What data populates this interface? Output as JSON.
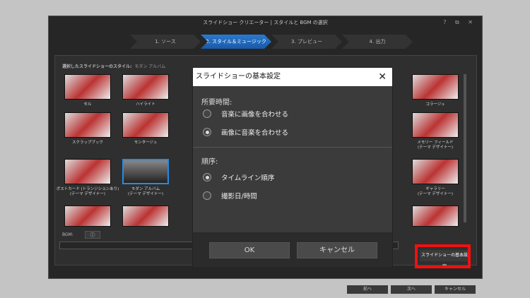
{
  "window": {
    "title": "スライドショー クリエーター | スタイルと BGM の選択",
    "controls": "? ⧉ ✕"
  },
  "steps": [
    "1. ソース",
    "2. スタイル＆ミュージック",
    "3. プレビュー",
    "4. 出力"
  ],
  "active_step": 1,
  "selected_style": {
    "label": "選択したスライドショーのスタイル:",
    "value": "モダン アルバム"
  },
  "styles": [
    {
      "label": "セル",
      "col": 0,
      "row": 0
    },
    {
      "label": "ハイライト",
      "col": 1,
      "row": 0
    },
    {
      "label": "コラージュ",
      "col": 6,
      "row": 0
    },
    {
      "label": "スクラップブック",
      "col": 0,
      "row": 1
    },
    {
      "label": "モンタージュ",
      "col": 1,
      "row": 1
    },
    {
      "label": "メモリー フィールド\n(テーマ デザイナー)",
      "col": 6,
      "row": 1
    },
    {
      "label": "ポストカード (トランジションあり)\n(テーマ デザイナー)",
      "col": 0,
      "row": 2
    },
    {
      "label": "モダン アルバム\n(テーマ デザイナー)",
      "col": 1,
      "row": 2,
      "selected": true
    },
    {
      "label": "ギャラリー\n(テーマ デザイナー)",
      "col": 6,
      "row": 2
    },
    {
      "label": "",
      "col": 0,
      "row": 3
    },
    {
      "label": "",
      "col": 1,
      "row": 3
    },
    {
      "label": "",
      "col": 6,
      "row": 3
    }
  ],
  "bgm": {
    "label": "BGM:",
    "info_icon": "ⓘ"
  },
  "basic_settings_button": "スライドショーの基本設定",
  "nav": {
    "prev": "前へ",
    "next": "次へ",
    "cancel": "キャンセル"
  },
  "highlight_color": "#f01010",
  "dialog": {
    "title": "スライドショーの基本設定",
    "close": "✕",
    "duration_label": "所要時間:",
    "duration_options": [
      {
        "label": "音楽に画像を合わせる",
        "checked": false
      },
      {
        "label": "画像に音楽を合わせる",
        "checked": true
      }
    ],
    "order_label": "順序:",
    "order_options": [
      {
        "label": "タイムライン順序",
        "checked": true
      },
      {
        "label": "撮影日/時間",
        "checked": false
      }
    ],
    "ok": "OK",
    "cancel": "キャンセル"
  }
}
